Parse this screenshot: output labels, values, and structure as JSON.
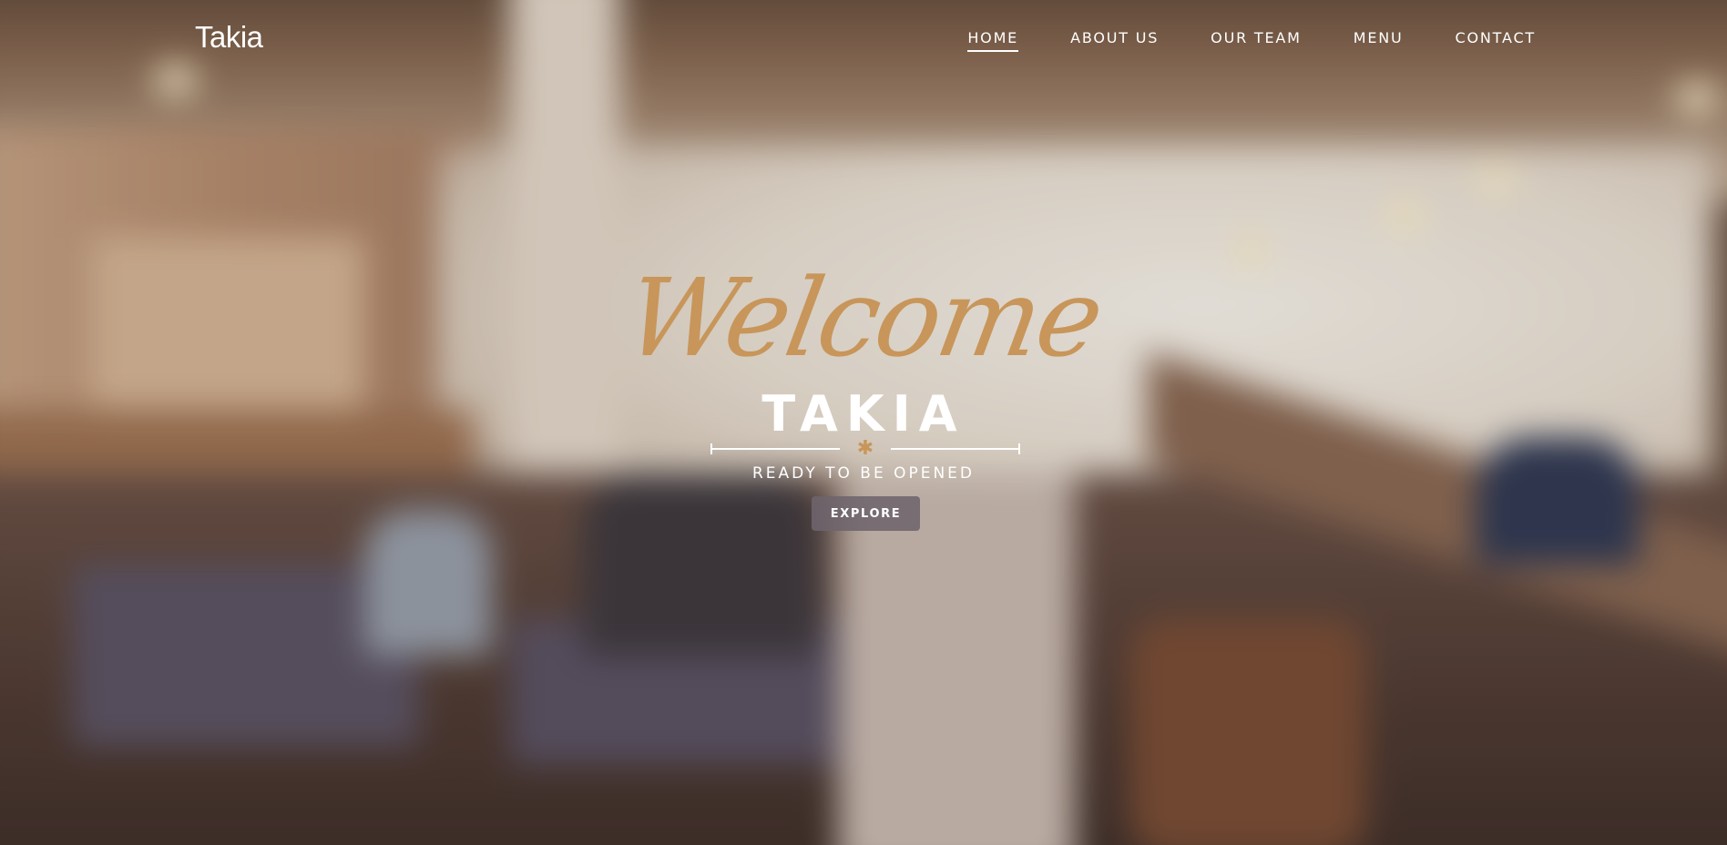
{
  "brand": {
    "name": "Takia"
  },
  "nav": {
    "items": [
      {
        "label": "HOME",
        "active": true
      },
      {
        "label": "ABOUT US",
        "active": false
      },
      {
        "label": "OUR TEAM",
        "active": false
      },
      {
        "label": "MENU",
        "active": false
      },
      {
        "label": "CONTACT",
        "active": false
      }
    ]
  },
  "hero": {
    "script_title": "Welcome",
    "site_name": "TAKIA",
    "divider_icon": "asterisk-icon",
    "tagline": "READY TO BE OPENED",
    "button_label": "EXPLORE"
  },
  "colors": {
    "accent_gold": "#c8965a",
    "text_white": "#ffffff",
    "button_bg": "#6e646c"
  }
}
